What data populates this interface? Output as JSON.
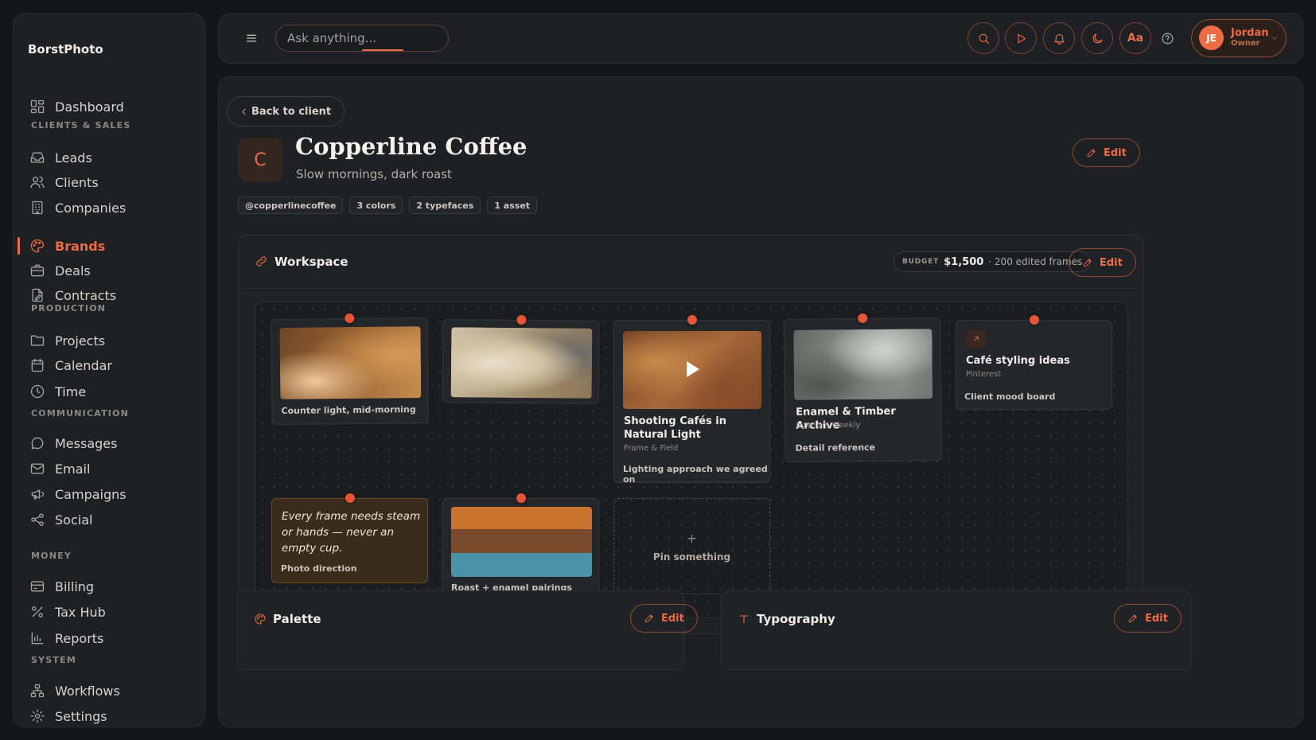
{
  "app": {
    "name": "BorstPhoto"
  },
  "sidebar": {
    "dashboard": "Dashboard",
    "sections": {
      "clients_sales": "CLIENTS & SALES",
      "production": "PRODUCTION",
      "communication": "COMMUNICATION",
      "money": "MONEY",
      "system": "SYSTEM"
    },
    "items": {
      "leads": "Leads",
      "clients": "Clients",
      "companies": "Companies",
      "brands": "Brands",
      "deals": "Deals",
      "contracts": "Contracts",
      "projects": "Projects",
      "calendar": "Calendar",
      "time": "Time",
      "messages": "Messages",
      "email": "Email",
      "campaigns": "Campaigns",
      "social": "Social",
      "billing": "Billing",
      "tax_hub": "Tax Hub",
      "reports": "Reports",
      "workflows": "Workflows",
      "settings": "Settings"
    },
    "active": "Brands"
  },
  "topbar": {
    "search_placeholder": "Ask anything...",
    "font_button": "Aa",
    "user": {
      "initials": "JE",
      "name": "Jordan",
      "role": "Owner"
    }
  },
  "brand": {
    "back_label": "Back to client",
    "logo_letter": "C",
    "name": "Copperline Coffee",
    "tagline": "Slow mornings, dark roast",
    "tags": [
      "@copperlinecoffee",
      "3 colors",
      "2 typefaces",
      "1 asset"
    ],
    "edit_label": "Edit"
  },
  "workspace": {
    "title": "Workspace",
    "budget_label": "BUDGET",
    "budget_value": "$1,500",
    "budget_note": "· 200 edited frames",
    "edit_label": "Edit",
    "pins": {
      "counter_light": {
        "caption": "Counter light, mid-morning"
      },
      "video": {
        "title": "Shooting Cafés in Natural Light",
        "source": "Frame & Field",
        "caption": "Lighting approach we agreed on"
      },
      "archive": {
        "title": "Enamel & Timber Archive",
        "source": "Interiors Weekly",
        "caption": "Detail reference"
      },
      "link": {
        "title": "Café styling ideas",
        "source": "Pinterest",
        "caption": "Client mood board"
      },
      "note": {
        "text": "Every frame needs steam or hands — never an empty cup.",
        "caption": "Photo direction"
      },
      "swatch": {
        "caption": "Roast + enamel pairings",
        "colors": [
          "#c9732e",
          "#7a4a2c",
          "#4a92a8"
        ]
      },
      "add": {
        "plus": "+",
        "label": "Pin something"
      }
    }
  },
  "palette": {
    "title": "Palette",
    "edit_label": "Edit"
  },
  "typography": {
    "title": "Typography",
    "edit_label": "Edit"
  },
  "colors": {
    "accent": "#ec6c45",
    "background": "#151618",
    "panel": "#1f2023"
  }
}
